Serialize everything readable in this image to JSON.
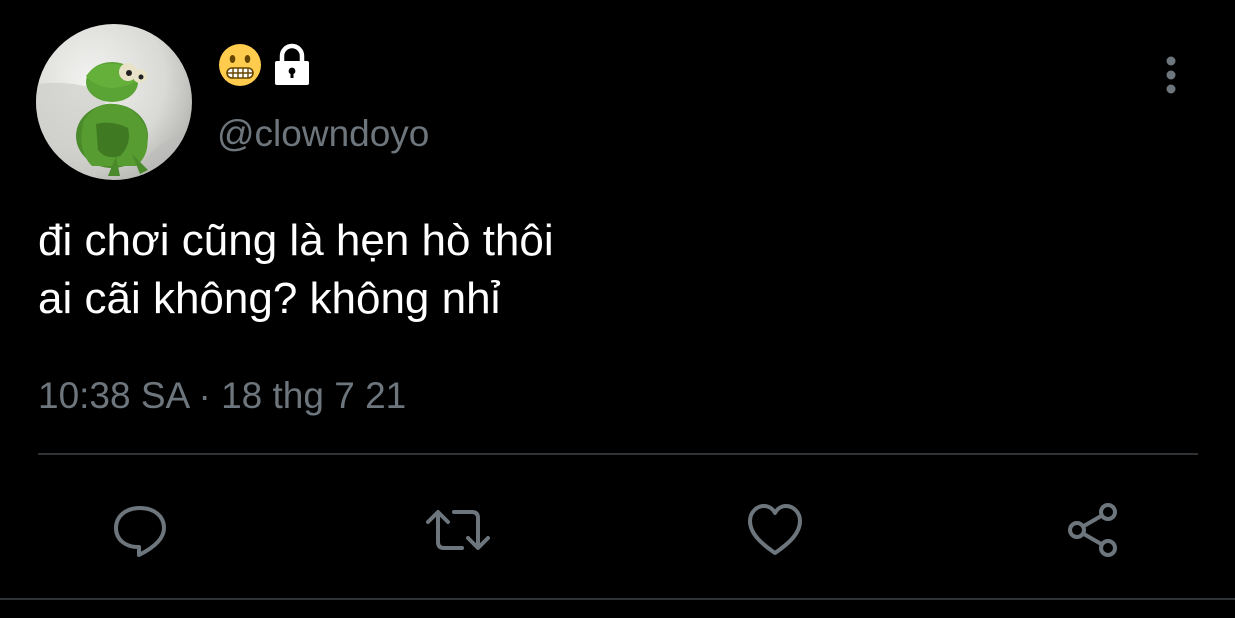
{
  "profile": {
    "handle": "@clowndoyo",
    "avatar_icon": "kermit-frog-avatar",
    "name_icons": [
      "grimacing-face-emoji-icon",
      "lock-icon"
    ]
  },
  "tweet": {
    "text_lines": [
      "đi chơi cũng là hẹn hò thôi",
      "ai cãi không? không nhỉ"
    ],
    "time": "10:38 SA",
    "separator": "·",
    "date": "18 thg 7 21"
  },
  "actions": [
    {
      "name": "reply",
      "icon": "comment-bubble-icon"
    },
    {
      "name": "retweet",
      "icon": "retweet-icon"
    },
    {
      "name": "like",
      "icon": "heart-icon"
    },
    {
      "name": "share",
      "icon": "share-icon"
    }
  ],
  "colors": {
    "background": "#000000",
    "text_primary": "#ffffff",
    "text_secondary": "#6e767d",
    "icon": "#6e767d",
    "divider": "#2f3336"
  }
}
